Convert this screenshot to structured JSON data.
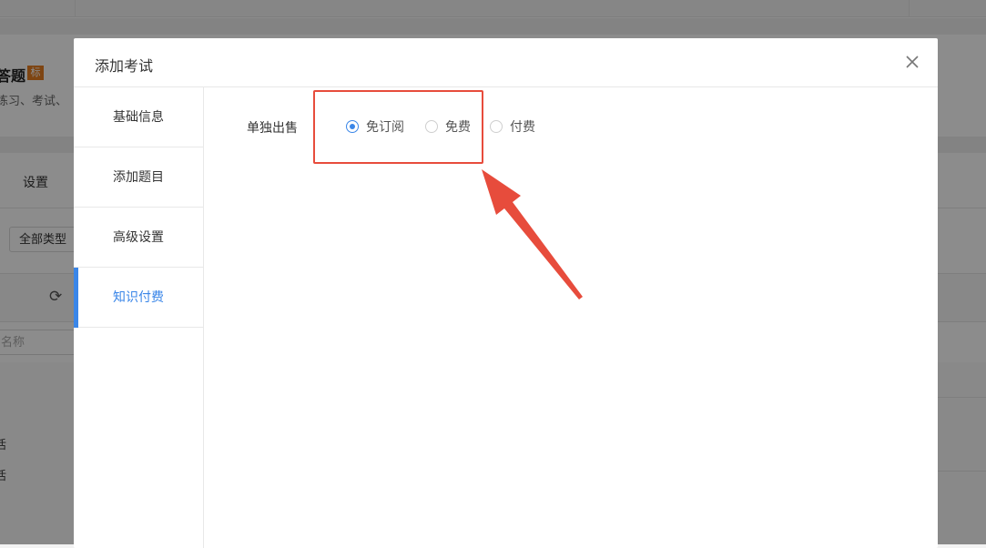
{
  "background": {
    "title": "答题",
    "badge": "标",
    "desc": "练习、考试、",
    "settings": "设置",
    "type_select": "全部类型",
    "refresh_icon": "refresh-icon",
    "name_placeholder": "名称",
    "frag1": "活",
    "frag2": "活"
  },
  "modal": {
    "title": "添加考试",
    "close_icon": "close-icon",
    "sidebar": {
      "items": [
        {
          "label": "基础信息",
          "active": false
        },
        {
          "label": "添加题目",
          "active": false
        },
        {
          "label": "高级设置",
          "active": false
        },
        {
          "label": "知识付费",
          "active": true
        }
      ]
    },
    "form": {
      "label": "单独出售",
      "options": [
        {
          "label": "免订阅",
          "checked": true
        },
        {
          "label": "免费",
          "checked": false
        },
        {
          "label": "付费",
          "checked": false
        }
      ]
    }
  },
  "annotation": {
    "box_color": "#e74c3c",
    "arrow_color": "#e74c3c"
  },
  "colors": {
    "accent": "#3a86e8",
    "badge": "#e67e22"
  }
}
